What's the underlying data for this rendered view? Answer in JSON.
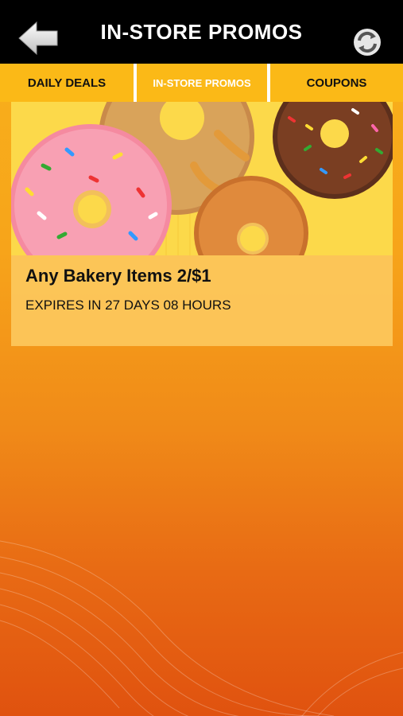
{
  "header": {
    "title": "IN-STORE PROMOS",
    "back_icon": "back-arrow-icon",
    "refresh_icon": "refresh-icon"
  },
  "tabs": [
    {
      "label": "DAILY DEALS",
      "active": false
    },
    {
      "label": "IN-STORE PROMOS",
      "active": true
    },
    {
      "label": "COUPONS",
      "active": false
    }
  ],
  "promos": [
    {
      "image": "donuts-photo",
      "title": "Any Bakery Items 2/$1",
      "expiry": "EXPIRES IN 27 DAYS 08 HOURS"
    }
  ],
  "colors": {
    "header_bg": "#000000",
    "tab_bg": "#fbb917",
    "background_top": "#f8b31c",
    "background_bottom": "#e0520f"
  }
}
